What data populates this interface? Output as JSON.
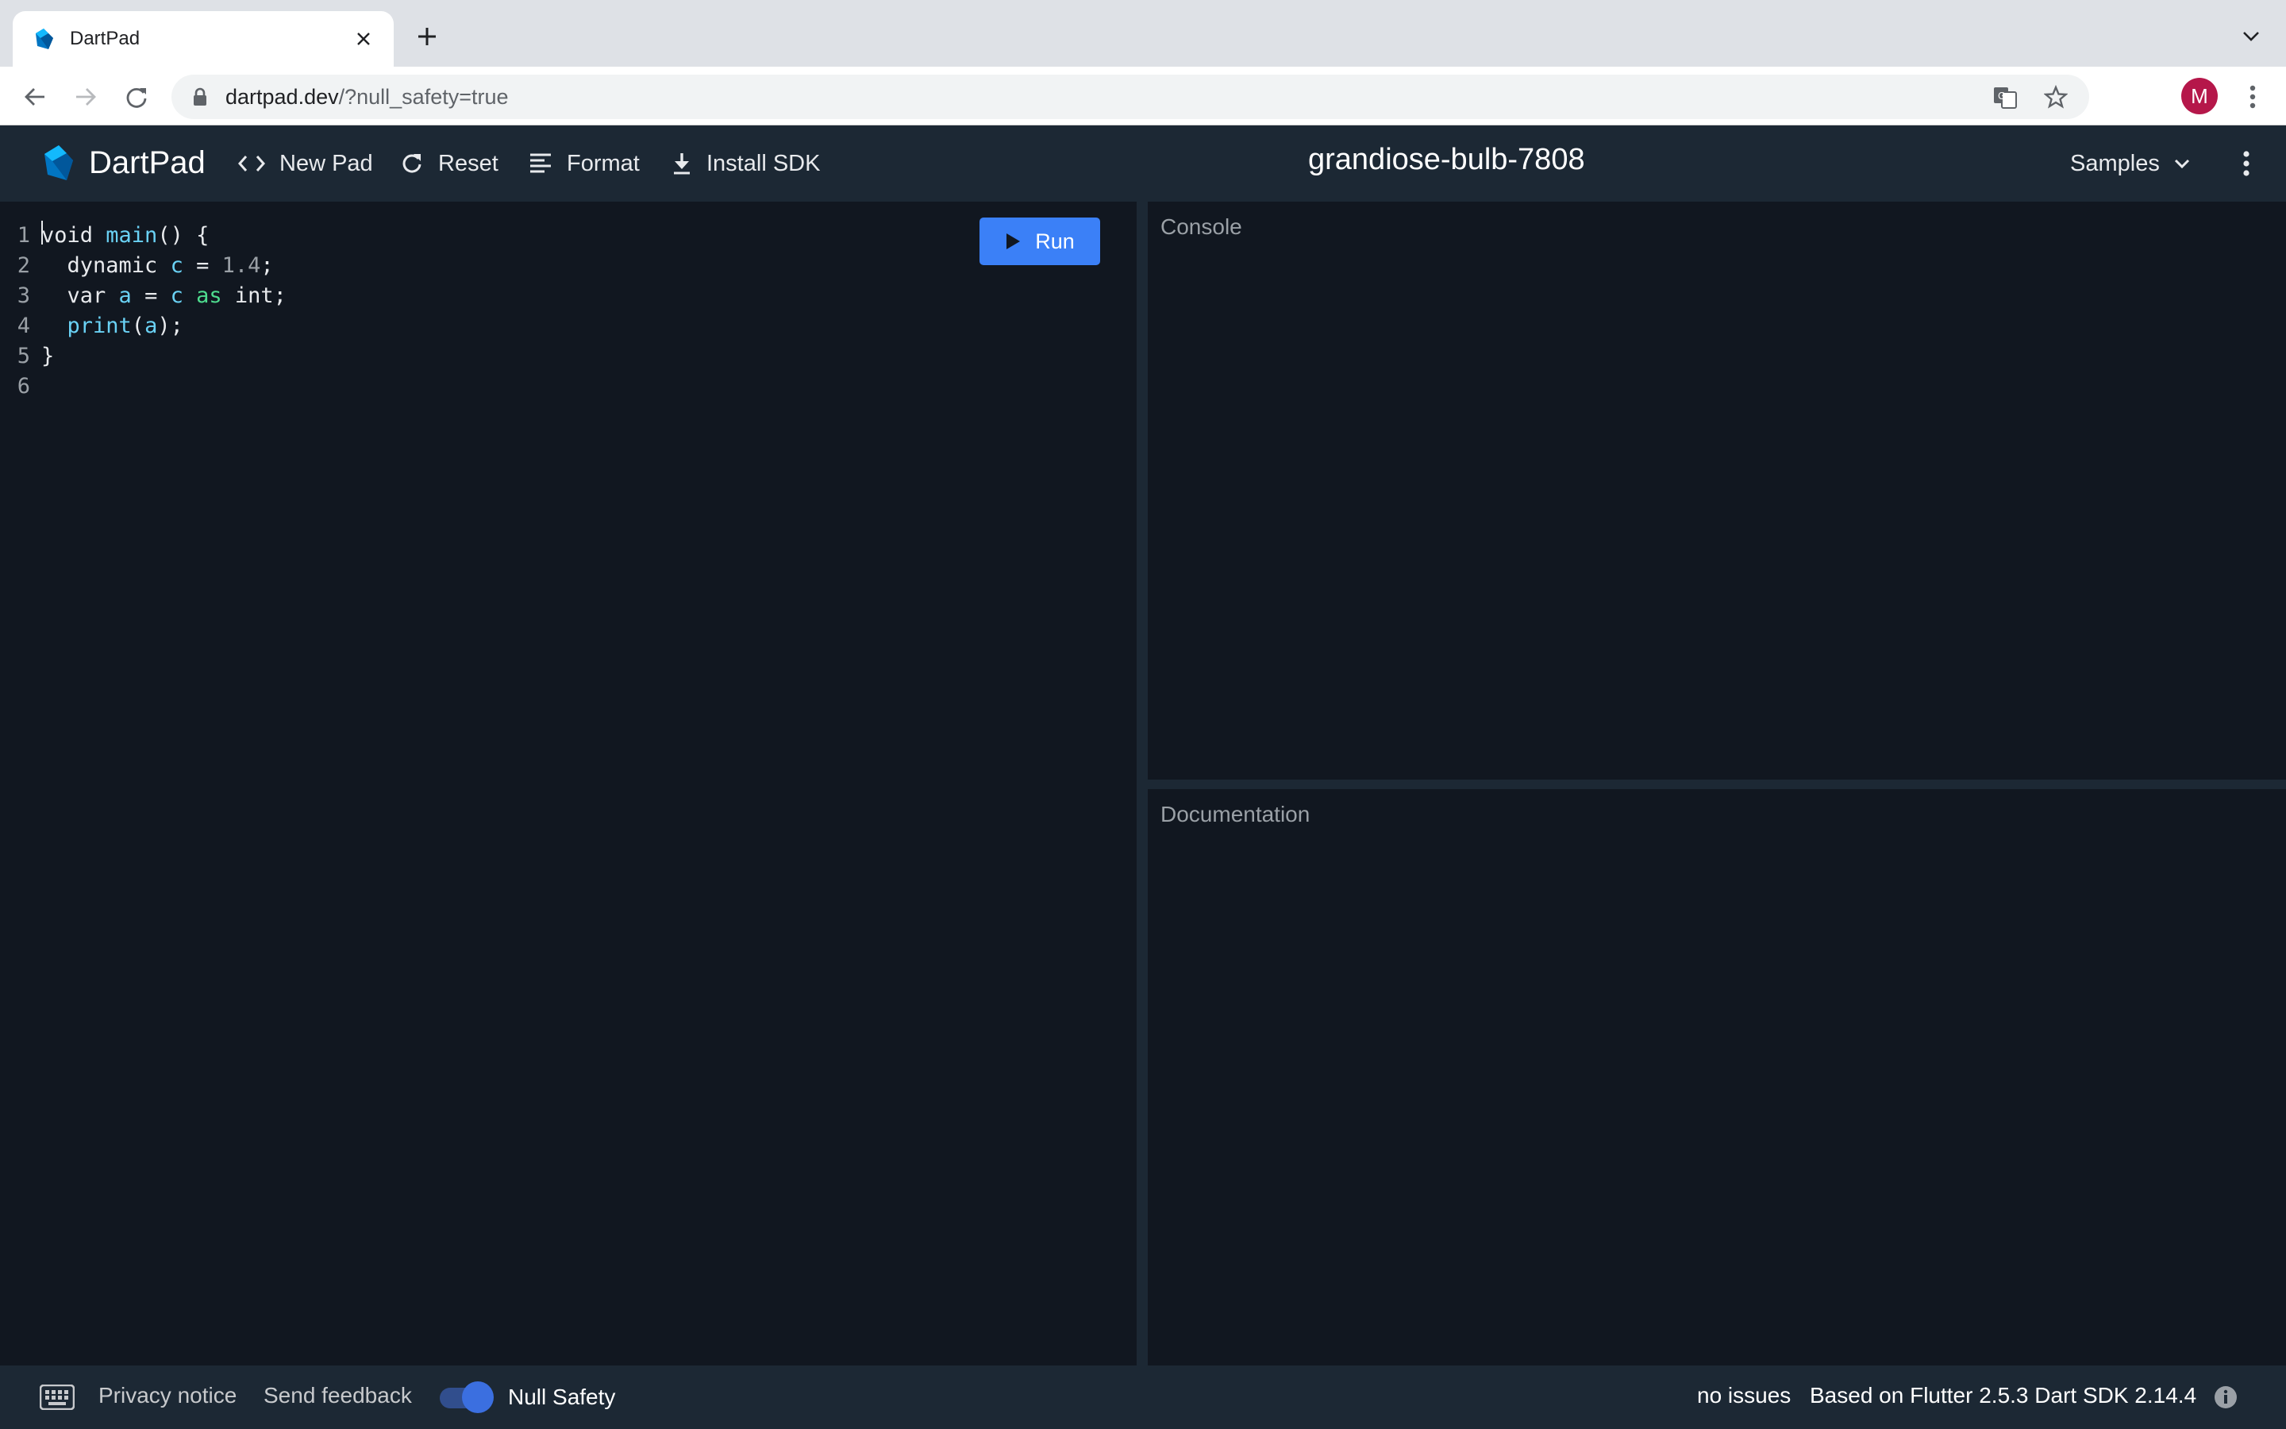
{
  "browser": {
    "tab_title": "DartPad",
    "url_host": "dartpad.dev",
    "url_rest": "/?null_safety=true",
    "profile_initial": "M"
  },
  "toolbar": {
    "logo_text": "DartPad",
    "new_pad": "New Pad",
    "reset": "Reset",
    "format": "Format",
    "install_sdk": "Install SDK",
    "pad_title": "grandiose-bulb-7808",
    "samples": "Samples"
  },
  "editor": {
    "run_label": "Run",
    "line_numbers": [
      "1",
      "2",
      "3",
      "4",
      "5",
      "6"
    ],
    "lines": [
      [
        {
          "t": "void ",
          "c": "txt"
        },
        {
          "t": "main",
          "c": "tok-fn"
        },
        {
          "t": "() {",
          "c": "txt"
        }
      ],
      [
        {
          "t": "  dynamic ",
          "c": "txt"
        },
        {
          "t": "c",
          "c": "tok-var"
        },
        {
          "t": " = ",
          "c": "txt"
        },
        {
          "t": "1.4",
          "c": "tok-num"
        },
        {
          "t": ";",
          "c": "txt"
        }
      ],
      [
        {
          "t": "  var ",
          "c": "txt"
        },
        {
          "t": "a",
          "c": "tok-var"
        },
        {
          "t": " = ",
          "c": "txt"
        },
        {
          "t": "c",
          "c": "tok-var"
        },
        {
          "t": " ",
          "c": "txt"
        },
        {
          "t": "as",
          "c": "tok-kw"
        },
        {
          "t": " int;",
          "c": "txt"
        }
      ],
      [
        {
          "t": "  ",
          "c": "txt"
        },
        {
          "t": "print",
          "c": "tok-fn"
        },
        {
          "t": "(",
          "c": "txt"
        },
        {
          "t": "a",
          "c": "tok-var"
        },
        {
          "t": ");",
          "c": "txt"
        }
      ],
      [
        {
          "t": "}",
          "c": "txt"
        }
      ],
      []
    ]
  },
  "panes": {
    "console_label": "Console",
    "docs_label": "Documentation"
  },
  "footer": {
    "privacy": "Privacy notice",
    "feedback": "Send feedback",
    "null_safety": "Null Safety",
    "null_safety_on": true,
    "issues": "no issues",
    "sdk_info": "Based on Flutter 2.5.3 Dart SDK 2.14.4"
  },
  "colors": {
    "run_button": "#3b80f7",
    "toolbar_bg": "#1c2834",
    "editor_bg": "#111720",
    "avatar": "#b5174a"
  }
}
